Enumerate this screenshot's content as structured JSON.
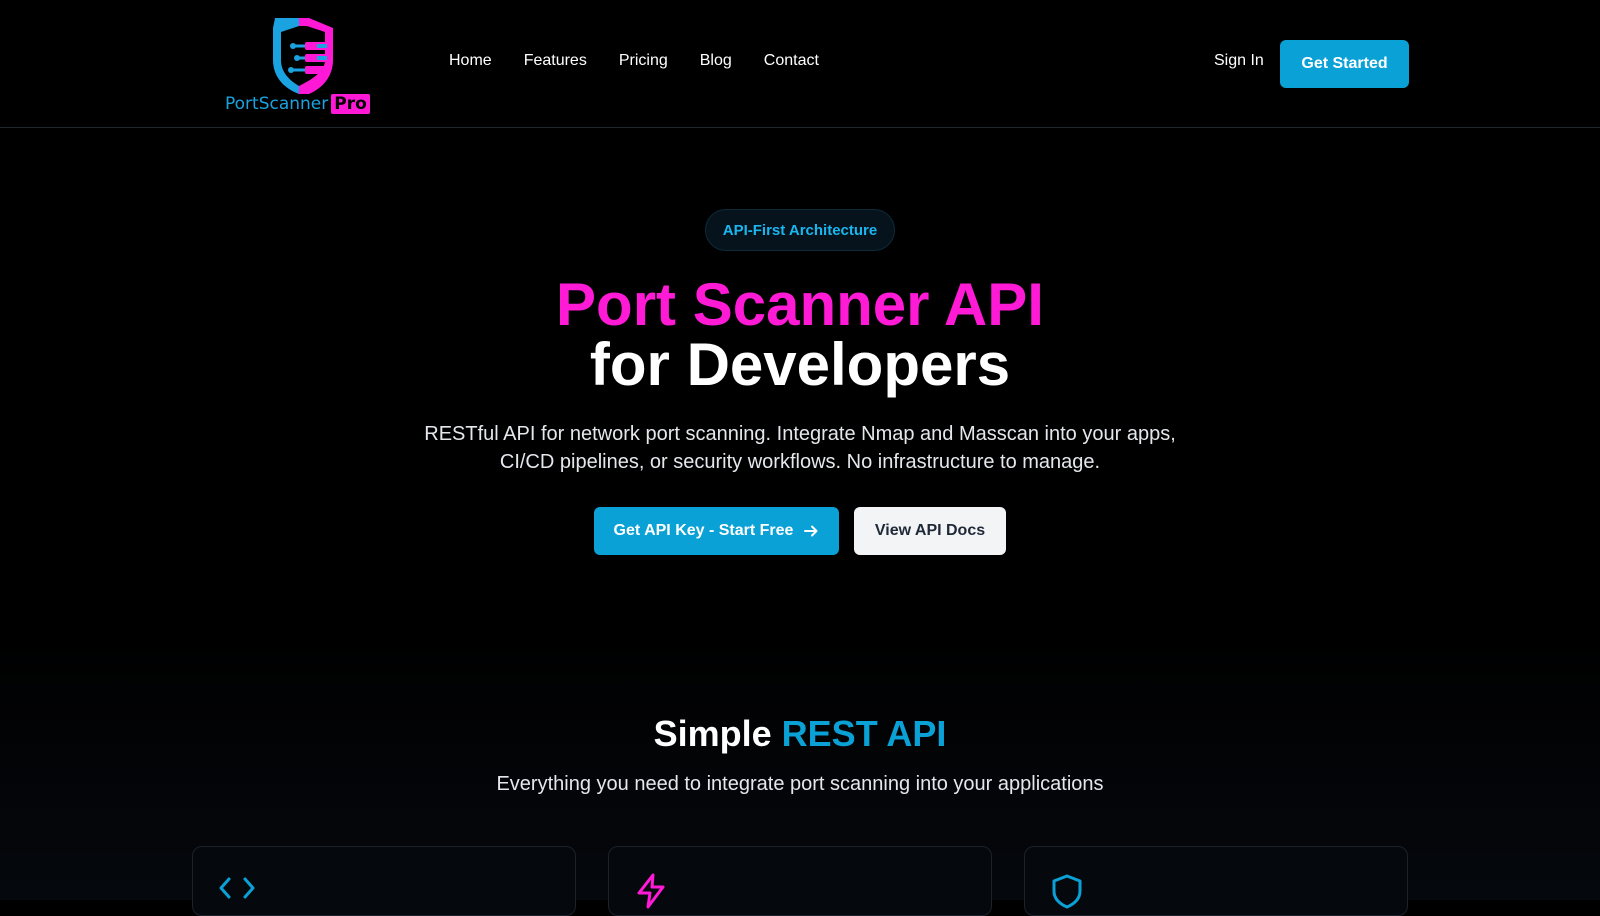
{
  "brand": {
    "name": "PortScanner",
    "suffix": "Pro",
    "colors": {
      "cyan": "#1aa3e0",
      "magenta": "#ff18d6"
    }
  },
  "nav": {
    "items": [
      "Home",
      "Features",
      "Pricing",
      "Blog",
      "Contact"
    ]
  },
  "header": {
    "sign_in": "Sign In",
    "get_started": "Get Started"
  },
  "hero": {
    "badge": "API-First Architecture",
    "title_line1": "Port Scanner API",
    "title_line2": "for Developers",
    "lead_line1": "RESTful API for network port scanning. Integrate Nmap and Masscan into your apps,",
    "lead_line2": "CI/CD pipelines, or security workflows. No infrastructure to manage.",
    "primary_button": "Get API Key - Start Free",
    "secondary_button": "View API Docs"
  },
  "section": {
    "title_plain": "Simple",
    "title_accent": "REST API",
    "subtitle": "Everything you need to integrate port scanning into your applications"
  },
  "cards": [
    {
      "icon": "code-icon",
      "color": "#0aa1d6"
    },
    {
      "icon": "lightning-icon",
      "color": "#ff1ad6"
    },
    {
      "icon": "shield-icon",
      "color": "#0aa1d6"
    }
  ]
}
